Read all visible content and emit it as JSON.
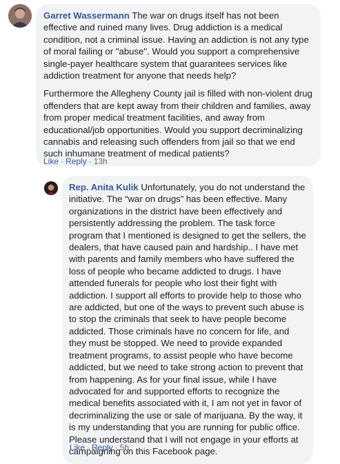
{
  "comments": [
    {
      "author": "Garret Wassermann",
      "paragraphs": [
        "The war on drugs itself has not been effective and ruined many lives. Drug addiction is a medical condition, not a criminal issue. Having an addiction is not any type of moral failing or \"abuse\". Would you support a comprehensive single-payer healthcare system that guarantees services like addiction treatment for anyone that needs help?",
        "Furthermore the Allegheny County jail is filled with non-violent drug offenders that are kept away from their children and families, away from proper medical treatment facilities, and away from educational/job opportunities. Would you support decriminalizing cannabis and releasing such offenders from jail so that we end such inhumane treatment of medical patients?"
      ],
      "actions": {
        "like": "Like",
        "reply": "Reply",
        "separator": "·",
        "time": "13h"
      }
    },
    {
      "author": "Rep. Anita Kulik",
      "paragraphs": [
        "Unfortunately, you do not understand the initiative. The “war on drugs” has been effective. Many organizations in the district have been effectively and persistently addressing the problem. The task force program that I mentioned is designed to get the sellers, the dealers, that have caused pain and hardship.. I have met with parents and family members who have suffered the loss of people who became addicted to drugs. I have attended funerals for people who lost their fight with addiction. I support all efforts to provide help to those who are addicted, but one of the ways to prevent such abuse is to stop the criminals that seek to have people become addicted. Those criminals have no concern for life, and they must be stopped. We need to provide expanded treatment programs, to assist people who have become addicted, but we need to take strong action to prevent that from happening. As for your final issue, while I have advocated for and supported efforts to recognize the medical benefits associated with it, I am not yet in favor of decriminalizing the use or sale of marijuana. By the way, it is my understanding that you are running for public office. Please understand that I will not engage in your efforts at campaigning on this Facebook page."
      ],
      "actions": {
        "like": "Like",
        "reply": "Reply",
        "separator": "·",
        "time": "5h"
      }
    }
  ],
  "colors": {
    "bubble_bg": "#f2f3f5",
    "author_link": "#385898",
    "text": "#1c1e21",
    "meta": "#606770"
  }
}
